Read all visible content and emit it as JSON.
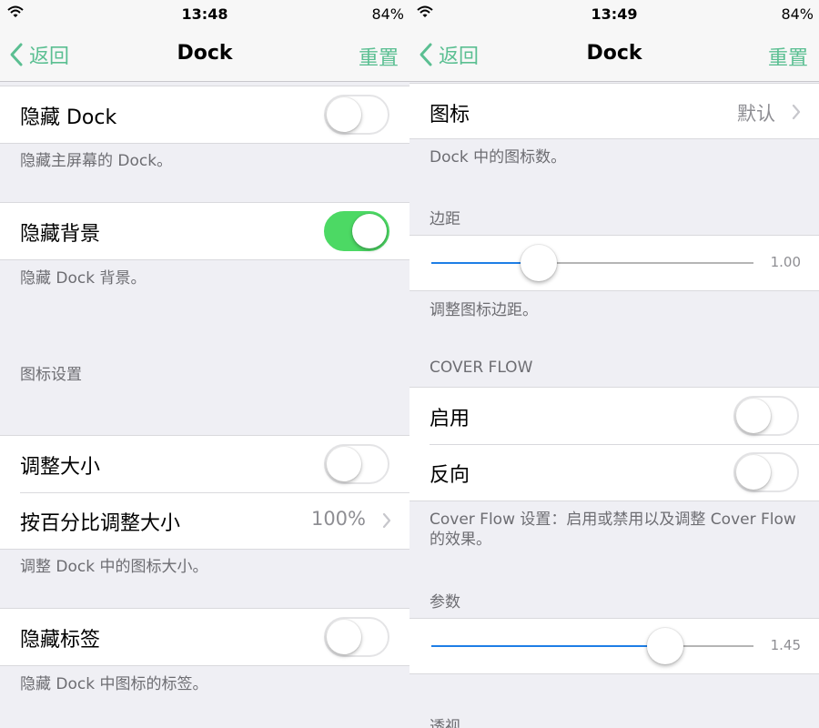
{
  "left": {
    "status": {
      "time": "13:48",
      "battery": "84%"
    },
    "nav": {
      "back": "返回",
      "title": "Dock",
      "reset": "重置"
    },
    "hide_dock": {
      "label": "隐藏 Dock",
      "on": false,
      "footer": "隐藏主屏幕的 Dock。"
    },
    "hide_background": {
      "label": "隐藏背景",
      "on": true,
      "footer": "隐藏 Dock 背景。"
    },
    "icon_section_header": "图标设置",
    "resize": {
      "label": "调整大小",
      "on": false
    },
    "resize_percent": {
      "label": "按百分比调整大小",
      "value": "100%"
    },
    "resize_footer": "调整 Dock 中的图标大小。",
    "hide_labels": {
      "label": "隐藏标签",
      "on": false,
      "footer": "隐藏 Dock 中图标的标签。"
    }
  },
  "right": {
    "status": {
      "time": "13:49",
      "battery": "84%"
    },
    "nav": {
      "back": "返回",
      "title": "Dock",
      "reset": "重置"
    },
    "icons": {
      "label": "图标",
      "value": "默认",
      "footer": "Dock 中的图标数。"
    },
    "spacing": {
      "header": "边距",
      "value": 1.0,
      "value_label": "1.00",
      "min": 0,
      "max": 3,
      "footer": "调整图标边距。"
    },
    "cover_flow": {
      "header": "COVER FLOW",
      "enable": {
        "label": "启用",
        "on": false
      },
      "reverse": {
        "label": "反向",
        "on": false
      },
      "footer": "Cover Flow 设置：启用或禁用以及调整 Cover Flow 的效果。"
    },
    "params": {
      "header": "参数",
      "value": 1.45,
      "value_label": "1.45",
      "min": 0,
      "max": 2
    },
    "perspective_header": "透视"
  },
  "colors": {
    "accent": "#5bbf92",
    "switch_on": "#4cd964",
    "slider_fill": "#1e7ee6",
    "background": "#efeff4"
  },
  "icons": [
    "wifi-icon",
    "back-chevron-icon",
    "chevron-right-icon"
  ]
}
